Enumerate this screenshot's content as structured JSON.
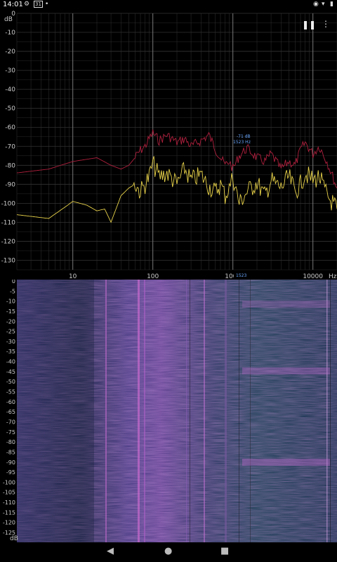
{
  "status_bar": {
    "time": "14:01",
    "left_icons": [
      "gear-icon",
      "calendar-icon",
      "dot-icon"
    ],
    "right_icons": [
      "eye-icon",
      "wifi-icon",
      "battery-icon"
    ]
  },
  "spectrum": {
    "unit_y": "dB",
    "unit_x": "Hz",
    "y_ticks": [
      "0",
      "-10",
      "-20",
      "-30",
      "-40",
      "-50",
      "-60",
      "-70",
      "-80",
      "-90",
      "-100",
      "-110",
      "-120",
      "-130"
    ],
    "x_ticks": [
      "10",
      "100",
      "1000",
      "10000"
    ],
    "peak_label_db": "-71 dB",
    "peak_label_hz": "1523 Hz",
    "marker_freq_label": "1523",
    "colors": {
      "peak_hold": "#b0203e",
      "live": "#e8d24a",
      "grid": "#333333",
      "annotation": "#6aa7ff"
    }
  },
  "spectrogram": {
    "y_ticks": [
      "0",
      "-5",
      "-10",
      "-15",
      "-20",
      "-25",
      "-30",
      "-35",
      "-40",
      "-45",
      "-50",
      "-55",
      "-60",
      "-65",
      "-70",
      "-75",
      "-80",
      "-85",
      "-90",
      "-95",
      "-100",
      "-105",
      "-110",
      "-115",
      "-120",
      "-125"
    ],
    "bottom_unit": "dB",
    "colors": {
      "low": "#1e2a45",
      "mid": "#5a4a8e",
      "high": "#d85ed0"
    }
  },
  "toolbar": {
    "pause_icon": "pause-icon",
    "menu_icon": "more-vert-icon"
  },
  "nav_bar": {
    "back_icon": "back-triangle-icon",
    "home_icon": "home-circle-icon",
    "recents_icon": "recents-square-icon"
  },
  "chart_data": {
    "type": "line",
    "x_scale": "log",
    "xlim": [
      2,
      20000
    ],
    "ylim": [
      -135,
      0
    ],
    "ylabel": "dB",
    "xlabel": "Hz",
    "grid": true,
    "series": [
      {
        "color": "#b0203e",
        "x": [
          2,
          5,
          10,
          20,
          30,
          40,
          50,
          60,
          70,
          80,
          90,
          100,
          120,
          150,
          200,
          250,
          300,
          400,
          500,
          600,
          700,
          800,
          900,
          1000,
          1200,
          1500,
          2000,
          2500,
          3000,
          4000,
          5000,
          6000,
          7000,
          8000,
          10000,
          12000,
          15000,
          20000
        ],
        "y": [
          -84,
          -82,
          -78,
          -76,
          -80,
          -82,
          -80,
          -76,
          -72,
          -70,
          -66,
          -63,
          -67,
          -64,
          -68,
          -66,
          -70,
          -67,
          -64,
          -71,
          -76,
          -80,
          -78,
          -82,
          -75,
          -71,
          -76,
          -78,
          -74,
          -82,
          -78,
          -80,
          -72,
          -68,
          -74,
          -70,
          -78,
          -92
        ]
      },
      {
        "color": "#e8d24a",
        "x": [
          2,
          5,
          8,
          10,
          15,
          20,
          25,
          30,
          40,
          50,
          60,
          70,
          80,
          90,
          100,
          120,
          150,
          200,
          250,
          300,
          400,
          500,
          600,
          700,
          800,
          900,
          1000,
          1200,
          1500,
          2000,
          2500,
          3000,
          4000,
          5000,
          6000,
          7000,
          8000,
          10000,
          12000,
          15000,
          20000
        ],
        "y": [
          -106,
          -108,
          -102,
          -99,
          -101,
          -104,
          -103,
          -110,
          -96,
          -92,
          -90,
          -94,
          -90,
          -86,
          -79,
          -86,
          -84,
          -90,
          -82,
          -88,
          -85,
          -91,
          -94,
          -90,
          -96,
          -92,
          -86,
          -100,
          -94,
          -89,
          -96,
          -88,
          -92,
          -86,
          -94,
          -90,
          -84,
          -88,
          -86,
          -96,
          -103
        ]
      }
    ]
  }
}
